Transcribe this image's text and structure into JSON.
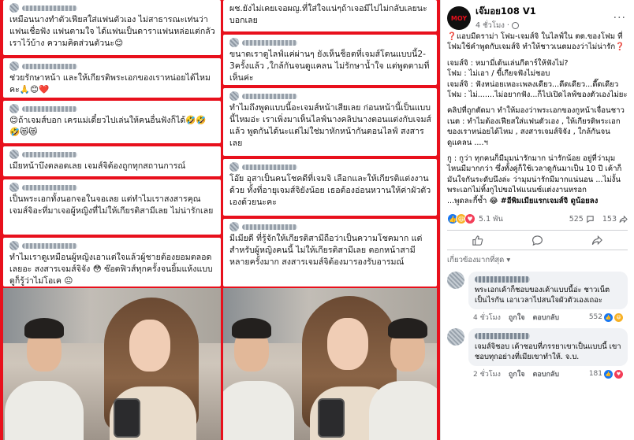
{
  "collage": {
    "left_comments": [
      "เหมือนนางทำตัวเฟียสใส่แฟนตัวเอง ไม่สาธารณะเท่นว่าแฟนเชื่อฟัง แฟนตามใจ ได้แฟนเป็นดาราแฟนหล่อแต่กลัวเราไว้บ้าง ความคิดส่วนตัวนะ😊",
      "ช่วยรักษาหน้า และให้เกียรติพระเอกของเราหน่อยได้ไหมคะ🙏😊❤️",
      "😊ถ้าเจมส์บอก เครแม่เดี๋ยวไปเล่นให้คนอื่นฟังก็ได้🤣🤣🤣😻😻",
      "เมียหน้าบึงตลอดเลย เจมส์จิต้องถูกทุกสถานการณ์",
      "เป็นพระเอกทั้งนอกจอในจอเลย แต่ทำไมเราสงสารคุณเจมส์จิอะที่มาเจอผู้หญิงที่ไม่ให้เกียรติสามีเลย ไม่น่ารักเลย",
      "ทำไมเราดูเหมือนผู้หญิงเอาแต่ใจแล้วผู้ชายต้องยอมตลอดเลยอะ สงสารเจมส์จิจัง 😳 ซ๊อตฟิวส์ทุกครั้งจนยิ้มแห้งแบบดูก็รู้ว่าไม่โอเค 😐"
    ],
    "right_comments": [
      "ผช.ยังไม่เคยเจอผญ.ที่ใส่ใจแน่ๆถ้าเจอมีไปไม่กลับเลยนะบอกเลย",
      "ขนาดเราดูไลฟ์แค่ผ่านๆ ยังเห็นช็อตที่เจมส์โดนแบบนี้2-3ครั้งแล้ว ,ใกล้กันจนดูแคลน ไม่รักษาน้ำใจ แต่พูดตามที่เห็นค่ะ",
      "ทำไมถึงพูดแบบนี้อะเจมส์หน้าเสียเลย ก่อนหน้านี้เป็นแบบนี้ไหมอ่ะ เราเพิ่งมาเห็นไลฟ์นางคลิปนางตอนแต่งกับเจมส์แล้ว พูดกันได้นะแต่ไม่ใช่มาหักหน้ากันตอนไลฟ์ สงสารเลย",
      "โอ๊ย อุสาเป็นคนโชคดีที่เจมจิ เลือกและให้เกียรติแต่งงานด้วย ทั้งที่อายุเจมส์จิยังน้อย เธอต้องอ่อนหวานให้ค่าผัวตัวเองด้วยนะคะ",
      "มีเมียดี ที่รู้จักให้เกียรติสามีถือว่าเป็นความโชคมาก แต่สำหรับผู้หญิงคนนี้ ไม่ให้เกียรติสามีเลย ตอกหน้าสามีหลายครั้งมาก สงสารเจมส์จิต้องมารองรับอารมณ์"
    ]
  },
  "post": {
    "page_name": "เจ๊มอย108 V1",
    "avatar_text": "MOY",
    "time": "4 ชั่วโมง",
    "body": [
      "❓แอบมีดราม่า โฟม-เจมส์จิ ในไลฟ์ใน ตต.ของโฟม ที่โฟมใช้คำพูดกับเจมส์จิ ทำให้ชาวเนตมองว่าไม่น่ารัก❓",
      "เจมส์จิ : หมามี่เต้นเล่นกีตาร์ให้ฟังไม่?\nโฟม : ไม่เอา / ขี้เกียจฟังไม่ชอบ\nเจมส์จิ : ฟังหน่อยเหอะเพลงเดียว...ดีดเดียว...ดี๊ดเดียว\nโฟม : ไม่.......ไม่อยากฟัง...ก็ไปเปิดไลฟ์ของตัวเองไม่ยะ",
      "คลิปที่ถูกตัดมา ทำให้มองว่าพระเอกของกูหน้าเจื่อนชาวเนต : ทำไมต้องเฟียสใส่แฟนตัวเอง , ให้เกียรติพระเอกของเราหน่อยได้ไหม , สงสารเจมส์จิจัง , ใกล้กันจนดูแคลน ....ฯ",
      "กู : กูว่า ทุกคนก็มีมุมน่ารักมาก น่ารักน้อย อยู่ที่ว่ามุมไหนมีมากกว่า ซึ่งทั้งคู่ก็ใช้เวลาดูกันมาเป็น 10 ปี เค้าก็มันใจกันระดับนึงล่ะ ว่ามุมน่ารักมีมากแน่นอน ...ไม่งั้นพระเอกไม่ทิ้งกูไปขอไฟแนนซ์แต่งงานหรอก\n...พูดละกี้ซ้ำ 😂 "
    ],
    "hashtag": "#อีพิมเมียแรกเจมส์จิ ดูน้อยลง",
    "reaction_count": "5.1 พัน",
    "comment_count": "525",
    "share_count": "153",
    "filter_label": "เกี่ยวข้องมากที่สุด",
    "comments": [
      {
        "text": "พระเอกเค้าก็ชอบของเค้าแบบนี้อ่ะ ชาวเน็ตเป็นไรกัน เอาเวลาไปสนใจผัวตัวเองเถอะ",
        "time": "4 ชั่วโมง",
        "like": "ถูกใจ",
        "reply": "ตอบกลับ",
        "reacts": "552"
      },
      {
        "text": "เจมส์จิชอบ เค้าชอบที่ภรรยาเขาเป็นแบบนี้ เขาชอบทุกอย่างที่เมียเขาทำให้. จ.บ.",
        "time": "2 ชั่วโมง",
        "like": "ถูกใจ",
        "reply": "ตอบกลับ",
        "reacts": "181"
      }
    ]
  },
  "colors": {
    "frame_red": "#e8101c",
    "fb_blue": "#1877f2",
    "muted": "#65676b"
  }
}
